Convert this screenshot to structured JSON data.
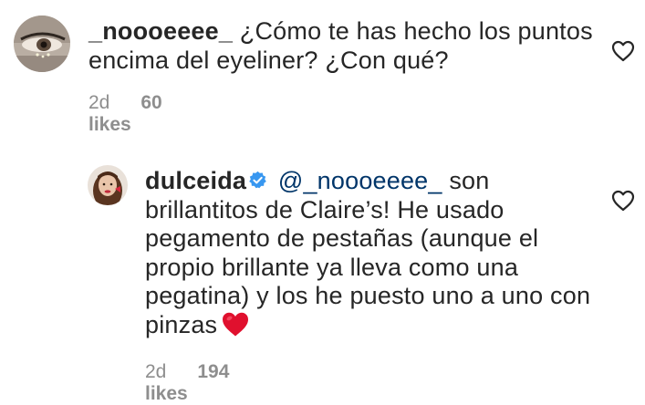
{
  "comments": [
    {
      "username": "_noooeeee_",
      "text": "¿Cómo te has hecho los puntos encima del eyeliner? ¿Con qué?",
      "time": "2d",
      "likes": "60 likes"
    },
    {
      "username": "dulceida",
      "verified": true,
      "mention": "@_noooeeee_",
      "text": "son brillantitos de Claire’s! He usado pegamento de pestañas (aunque el propio brillante ya lleva como una pegatina) y los he puesto uno a uno con pinzas",
      "emoji": "red-heart",
      "time": "2d",
      "likes": "194 likes"
    }
  ],
  "icons": {
    "like": "heart-outline-icon",
    "verified": "verified-badge-icon"
  },
  "colors": {
    "text": "#262626",
    "muted": "#8e8e8e",
    "mention": "#003569",
    "verified": "#3897f0",
    "heart_emoji": "#e0102e"
  }
}
